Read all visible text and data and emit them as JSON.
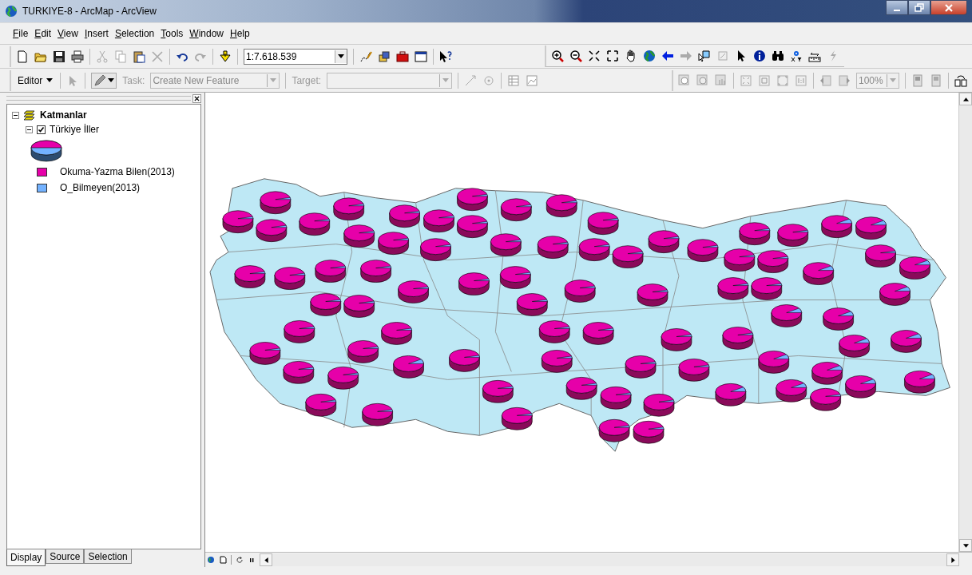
{
  "window": {
    "title": "TURKIYE-8 - ArcMap - ArcView"
  },
  "menu": [
    {
      "label": "File"
    },
    {
      "label": "Edit"
    },
    {
      "label": "View"
    },
    {
      "label": "Insert"
    },
    {
      "label": "Selection"
    },
    {
      "label": "Tools"
    },
    {
      "label": "Window"
    },
    {
      "label": "Help"
    }
  ],
  "standard_toolbar": {
    "scale": "1:7.618.539"
  },
  "editor_toolbar": {
    "editor": "Editor",
    "task": {
      "label": "Task:",
      "value": "Create New Feature",
      "disabled": true
    },
    "target": {
      "label": "Target:",
      "disabled": true
    },
    "zoom": {
      "value": "100%",
      "disabled": true
    }
  },
  "toc": {
    "label": "Katmanlar",
    "expanded": true,
    "layers": [
      {
        "label": "Türkiye İller",
        "checked": true,
        "expanded": true,
        "legend": [
          {
            "label": "Okuma-Yazma Bilen(2013)",
            "color": "#e600a9"
          },
          {
            "label": "O_Bilmeyen(2013)",
            "color": "#73b2ff"
          }
        ]
      }
    ]
  },
  "tabs": [
    {
      "label": "Display",
      "selected": true
    },
    {
      "label": "Source",
      "selected": false
    },
    {
      "label": "Selection",
      "selected": false
    }
  ]
}
